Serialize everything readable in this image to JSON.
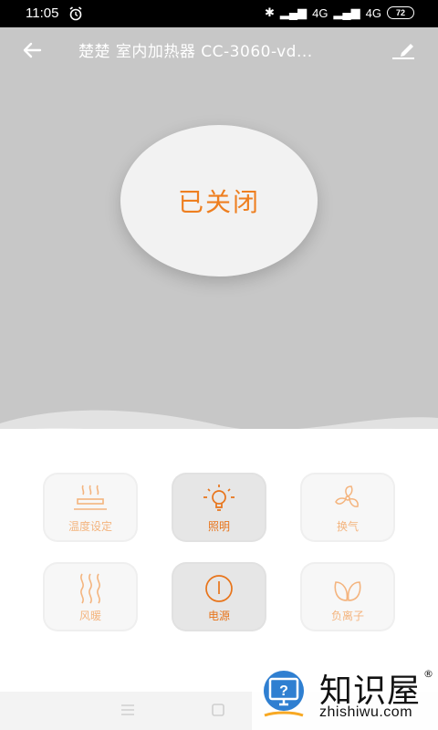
{
  "status_bar": {
    "time": "11:05",
    "network_1": "4G",
    "network_2": "4G",
    "battery": "72"
  },
  "header": {
    "title": "楚楚  室内加热器  CC-3060-vd..."
  },
  "power": {
    "status_label": "已关闭"
  },
  "controls": [
    {
      "label": "温度设定",
      "icon": "heater-waves-icon",
      "active": false
    },
    {
      "label": "照明",
      "icon": "light-bulb-icon",
      "active": true
    },
    {
      "label": "换气",
      "icon": "fan-icon",
      "active": false
    },
    {
      "label": "风暖",
      "icon": "warm-air-icon",
      "active": false
    },
    {
      "label": "电源",
      "icon": "power-icon",
      "active": true
    },
    {
      "label": "负离子",
      "icon": "leaf-icon",
      "active": false
    }
  ],
  "watermark": {
    "name_cn": "知识屋",
    "name_en": "zhishiwu.com"
  },
  "colors": {
    "accent": "#ee7f20",
    "hero_bg": "#c7c7c7",
    "inactive_icon": "#f4b47e"
  }
}
